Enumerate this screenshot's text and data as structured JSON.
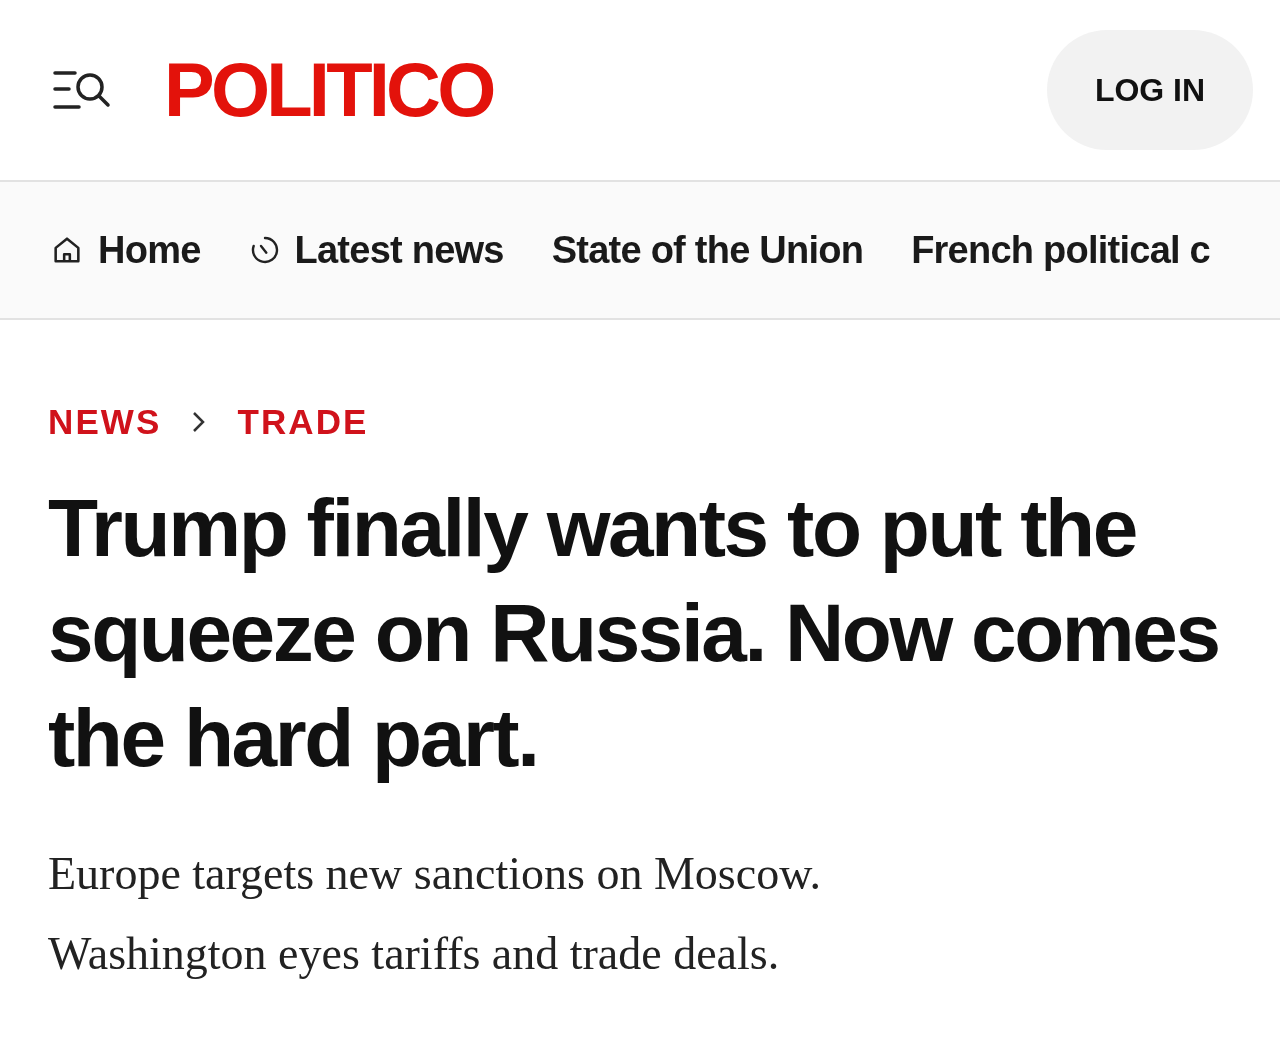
{
  "header": {
    "logo": "POLITICO",
    "login_button": "LOG IN"
  },
  "nav": {
    "items": [
      {
        "label": "Home",
        "kind": "home"
      },
      {
        "label": "Latest news",
        "kind": "latest"
      },
      {
        "label": "State of the Union",
        "kind": "text"
      },
      {
        "label": "French political c",
        "kind": "text"
      }
    ]
  },
  "breadcrumb": [
    "NEWS",
    "TRADE"
  ],
  "article": {
    "headline": "Trump finally wants to put the squeeze on Russia. Now comes the hard part.",
    "dek": "Europe targets new sanctions on Moscow. Washington eyes tariffs and trade deals."
  }
}
